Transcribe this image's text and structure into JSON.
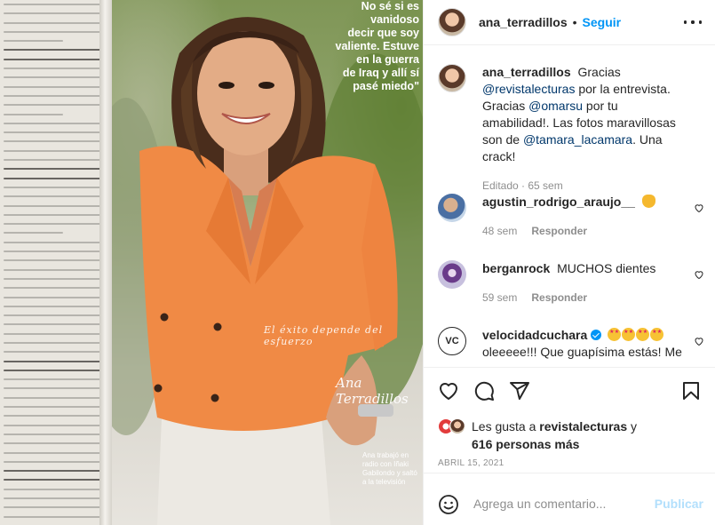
{
  "photo": {
    "quote_lines": [
      "No sé si es",
      "vanidoso",
      "decir que soy",
      "valiente. Estuve",
      "en la guerra",
      "de Iraq y allí sí",
      "pasé miedo\""
    ],
    "sign_phrase": "El éxito depende del esfuerzo",
    "signature": "Ana Terradillos",
    "caption": "Ana trabajó en radio con Iñaki Gabilondo y saltó a la televisión"
  },
  "header": {
    "username": "ana_terradillos",
    "separator": "•",
    "follow_label": "Seguir",
    "more_icon": "more-horizontal-icon"
  },
  "caption_post": {
    "username": "ana_terradillos",
    "text_1": "Gracias",
    "mention_1": "@revistalecturas",
    "text_2": "por la entrevista. Gracias",
    "mention_2": "@omarsu",
    "text_3": "por tu amabilidad!. Las fotos maravillosas son de",
    "mention_3": "@tamara_lacamara",
    "text_4": ". Una crack!",
    "meta": "Editado · 65 sem"
  },
  "comments": [
    {
      "username": "agustin_rodrigo_araujo__",
      "text": "",
      "time": "48 sem",
      "reply": "Responder"
    },
    {
      "username": "berganrock",
      "text": "MUCHOS dientes",
      "time": "59 sem",
      "reply": "Responder"
    },
    {
      "username": "velocidadcuchara",
      "avatar_text": "VC",
      "text": "oleeeee!!! Que guapísima estás! Me"
    }
  ],
  "likes": {
    "prefix": "Les gusta a",
    "user": "revistalecturas",
    "suffix": "y",
    "others": "616 personas más"
  },
  "date": "ABRIL 15, 2021",
  "add_comment": {
    "placeholder": "Agrega un comentario...",
    "publish_label": "Publicar"
  },
  "colors": {
    "link": "#00376b",
    "follow": "#0095f6",
    "publish_disabled": "#b2dffc",
    "jacket": "#f08a45"
  }
}
